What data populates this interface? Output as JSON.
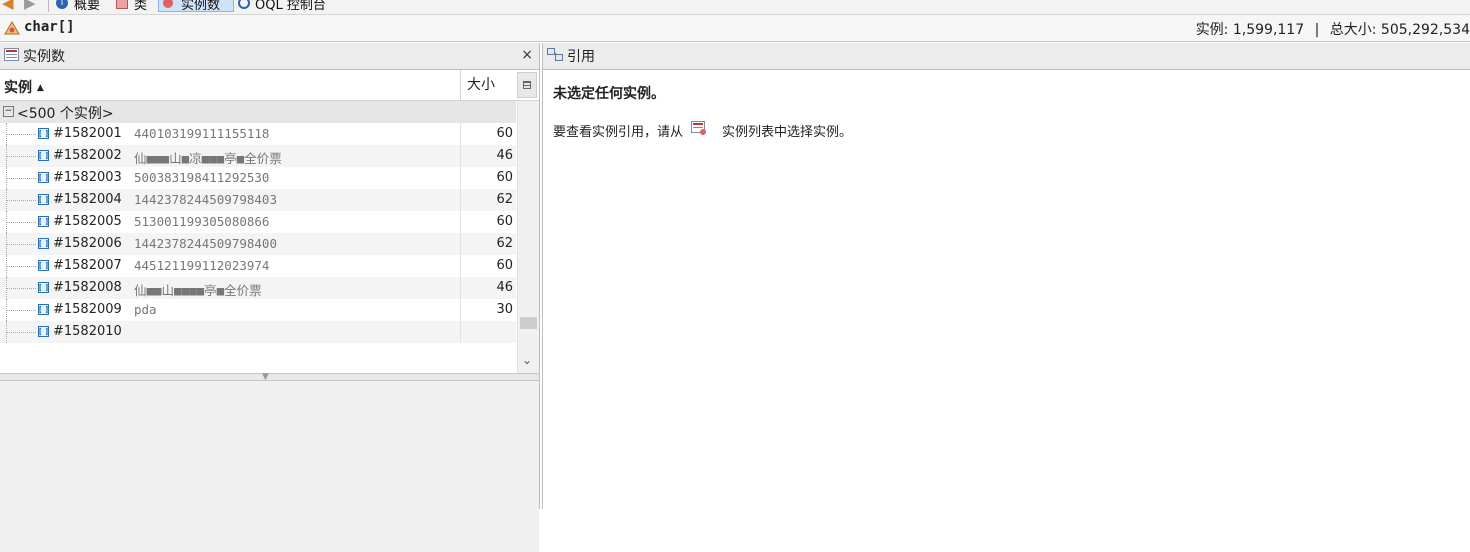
{
  "toolbar": {
    "items": [
      {
        "label": "概要",
        "icon": "info-icon"
      },
      {
        "label": "类",
        "icon": "classes-icon"
      },
      {
        "label": "实例数",
        "icon": "instances-icon"
      },
      {
        "label": "OQL 控制台",
        "icon": "oql-icon"
      }
    ],
    "active": "实例数"
  },
  "class_bar": {
    "class_name": "char[]",
    "instances_label": "实例:",
    "instances_value": "1,599,117",
    "separator": "|",
    "size_label": "总大小:",
    "size_value": "505,292,534"
  },
  "left_panel": {
    "title": "实例数",
    "close": "×",
    "columns": {
      "instance": "实例",
      "sort_indicator": "▲",
      "size": "大小"
    },
    "group_label": "<500 个实例>",
    "rows": [
      {
        "id": "#1582001",
        "value": "440103199111155118",
        "size": "60"
      },
      {
        "id": "#1582002",
        "value": "仙■■■山■凉■■■亭■全价票",
        "size": "46"
      },
      {
        "id": "#1582003",
        "value": "500383198411292530",
        "size": "60"
      },
      {
        "id": "#1582004",
        "value": "1442378244509798403",
        "size": "62"
      },
      {
        "id": "#1582005",
        "value": "513001199305080866",
        "size": "60"
      },
      {
        "id": "#1582006",
        "value": "1442378244509798400",
        "size": "62"
      },
      {
        "id": "#1582007",
        "value": "445121199112023974",
        "size": "60"
      },
      {
        "id": "#1582008",
        "value": "仙■■山■■■■亭■全价票",
        "size": "46"
      },
      {
        "id": "#1582009",
        "value": "pda",
        "size": "30"
      },
      {
        "id": "#1582010",
        "value": "",
        "size": ""
      }
    ]
  },
  "right_panel": {
    "title": "引用",
    "message_title": "未选定任何实例。",
    "message_before": "要查看实例引用，请从",
    "message_after": "实例列表中选择实例。"
  },
  "colors": {
    "active_tab_bg": "#cfe3f8",
    "group_row_bg": "#e6e6e6",
    "value_text": "#777777",
    "ref_icon": "#2b6fb7"
  }
}
